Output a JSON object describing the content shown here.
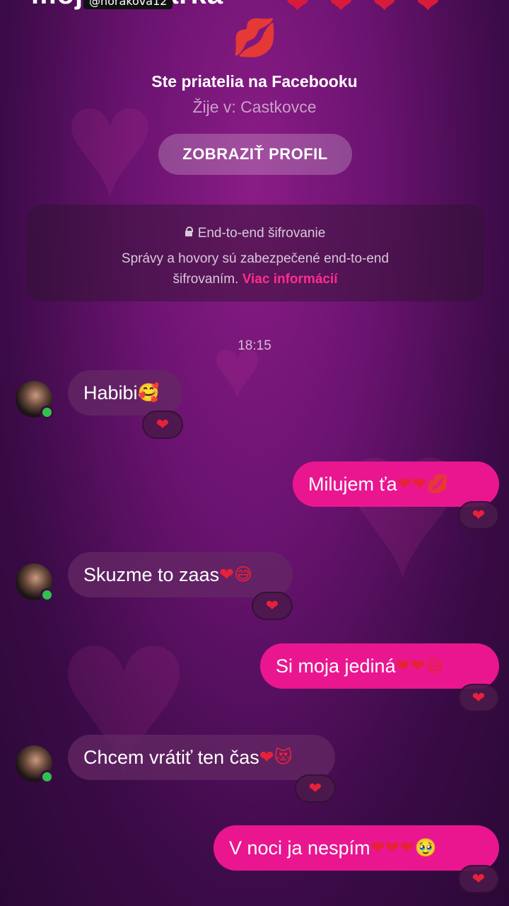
{
  "header": {
    "title_fragment": "moja … šarka",
    "watermark": "@horakova12",
    "top_hearts": "❤❤❤❤",
    "kiss_icon": "💋"
  },
  "profile": {
    "friends_text": "Ste priatelia na Facebooku",
    "lives_in": "Žije v: Castkovce",
    "view_profile_button": "ZOBRAZIŤ PROFIL"
  },
  "encryption": {
    "title": "End-to-end šifrovanie",
    "body": "Správy a hovory sú zabezpečené end-to-end šifrovaním.",
    "more_link": "Viac informácií"
  },
  "timestamp": "18:15",
  "messages": [
    {
      "dir": "in",
      "text": "Habibi",
      "emoji": "🥰",
      "reaction": "❤"
    },
    {
      "dir": "out",
      "text": "Milujem ťa ",
      "emoji": "❤❤💋",
      "reaction": "❤"
    },
    {
      "dir": "in",
      "text": "Skuzme to zaas",
      "emoji": "❤😅",
      "reaction": "❤"
    },
    {
      "dir": "out",
      "text": "Si moja jediná ",
      "emoji": "❤❤😅",
      "reaction": "❤"
    },
    {
      "dir": "in",
      "text": "Chcem vrátiť ten čas",
      "emoji": "❤😻",
      "reaction": "❤"
    },
    {
      "dir": "out",
      "text": "V noci ja nespím ",
      "emoji": "❤❤❤🥹",
      "reaction": "❤"
    }
  ],
  "colors": {
    "outgoing": "#ea1690",
    "incoming": "#64286e",
    "link": "#ff2d8e"
  }
}
